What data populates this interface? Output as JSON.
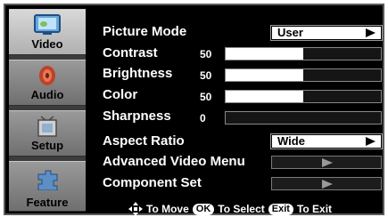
{
  "sidebar": {
    "items": [
      {
        "label": "Video",
        "icon": "video-icon",
        "active": true
      },
      {
        "label": "Audio",
        "icon": "speaker-icon",
        "active": false
      },
      {
        "label": "Setup",
        "icon": "setup-icon",
        "active": false
      },
      {
        "label": "Feature",
        "icon": "feature-icon",
        "active": false
      }
    ]
  },
  "menu": {
    "picture_mode": {
      "label": "Picture Mode",
      "value": "User"
    },
    "contrast": {
      "label": "Contrast",
      "value": "50",
      "level": 0.5
    },
    "brightness": {
      "label": "Brightness",
      "value": "50",
      "level": 0.5
    },
    "color": {
      "label": "Color",
      "value": "50",
      "level": 0.5
    },
    "sharpness": {
      "label": "Sharpness",
      "value": "0",
      "level": 0.0
    },
    "aspect_ratio": {
      "label": "Aspect Ratio",
      "value": "Wide"
    },
    "advanced_video": {
      "label": "Advanced Video Menu"
    },
    "component_set": {
      "label": "Component  Set"
    }
  },
  "footer": {
    "move": "To Move",
    "ok_key": "OK",
    "select": "To Select",
    "exit_key": "Exit",
    "exit": "To Exit"
  },
  "colors": {
    "background": "#000000",
    "text": "#ffffff",
    "sidebar_active": "#c8c8c8",
    "sidebar_inactive": "#858585"
  }
}
